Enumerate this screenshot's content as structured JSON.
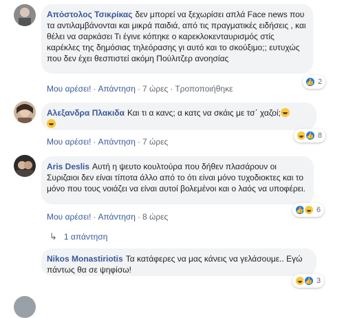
{
  "comments": [
    {
      "author": "Απόστολος Τσικρίκας",
      "text": "δεν μπορεί να ξεχωρίσει απλά Face news που τα αντιλαμβάνονται και μικρά παιδιά, από τις πραγματικές ειδήσεις , και θέλει να σαρκάσει Τι έγινε κόπηκε ο καρεκλοκενταυρισμός στίς καρέκλες της δημόσιας τηλεόρασης γι αυτό και το σκούξιμο;; ευτυχώς που δεν έχει θεσπιστεί ακόμη Πούλιτζερ ανοησίας",
      "like": "Μου αρέσει!",
      "reply": "Απάντηση",
      "time": "7 ώρες",
      "edited": "Τροποποιήθηκε",
      "reactions": "2",
      "reaction_icons": [
        "like-icon"
      ]
    },
    {
      "author": "Αλεξανδρα Πλακιδα",
      "text": "Και τι α κανς; α κατς να σκάις με τσ΄ χαζοί;",
      "like": "Μου αρέσει!",
      "reply": "Απάντηση",
      "time": "7 ώρες",
      "reactions": "8",
      "reaction_icons": [
        "haha-icon",
        "like-icon"
      ]
    },
    {
      "author": "Aris Deslis",
      "text": "Αυτή η ψευτο κουλτούρα που δήθεν πλασάρουν οι Συριζαιοι δεν είναι τίποτα άλλο από το ότι είναι μόνο τυχοδιοκτες και το μόνο που τους νοιάζει να είναι αυτοί βολεμένοι και ο λαός να υποφέρει.",
      "like": "Μου αρέσει!",
      "reply": "Απάντηση",
      "time": "8 ώρες",
      "reactions": "6",
      "reaction_icons": [
        "like-icon",
        "haha-icon"
      ]
    },
    {
      "author": "Nikos Monastiriotis",
      "text": "Τα κατάφερες να μας κάνεις να γελάσουμε.. Εγώ πάντως θα σε ψηφίσω!",
      "reactions": "3",
      "reaction_icons": [
        "haha-icon",
        "like-icon"
      ]
    }
  ],
  "replies_link": "1 απάντηση",
  "separator": "·",
  "colors": {
    "link": "#385898",
    "bubble": "#f2f3f5",
    "meta": "#606770",
    "like": "#1877f2",
    "haha": "#f7c83e"
  }
}
